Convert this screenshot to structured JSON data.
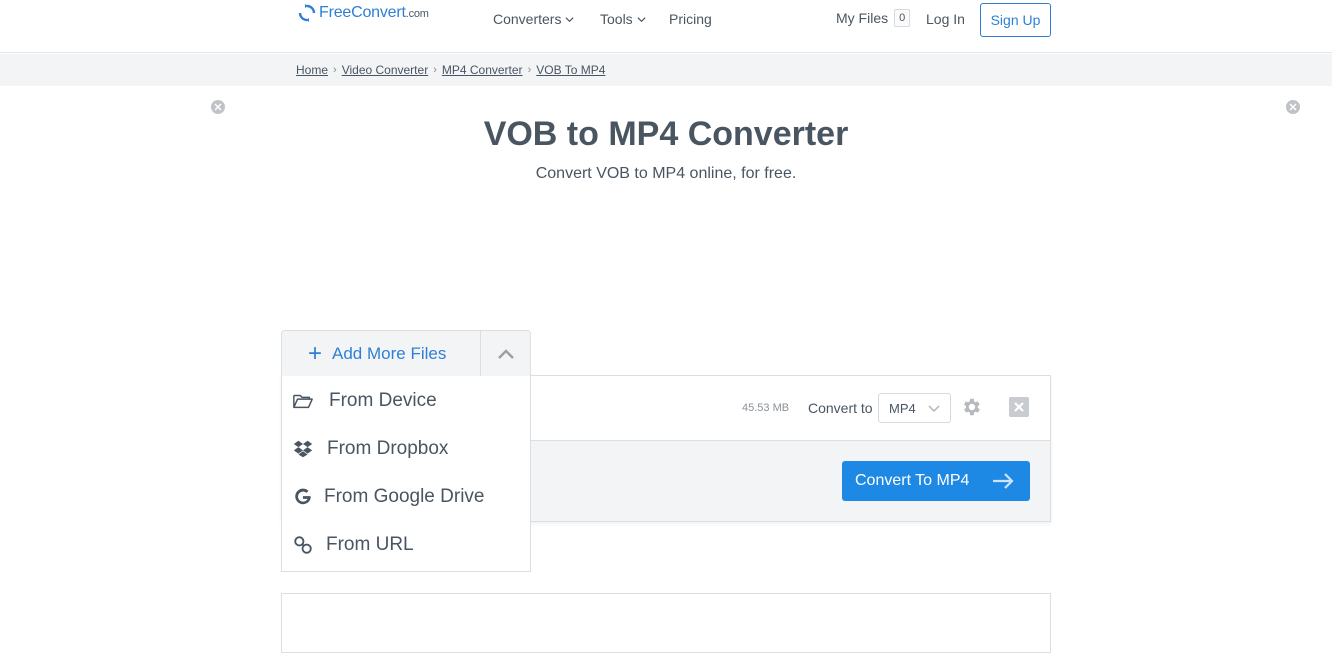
{
  "header": {
    "logo_name": "FreeConvert",
    "logo_domain": ".com",
    "nav": [
      {
        "label": "Converters",
        "has_dropdown": true
      },
      {
        "label": "Tools",
        "has_dropdown": true
      },
      {
        "label": "Pricing",
        "has_dropdown": false
      }
    ],
    "my_files_label": "My Files",
    "my_files_count": "0",
    "login_label": "Log In",
    "signup_label": "Sign Up"
  },
  "breadcrumb": [
    "Home",
    "Video Converter",
    "MP4 Converter",
    "VOB To MP4"
  ],
  "page": {
    "title": "VOB to MP4 Converter",
    "subtitle": "Convert VOB to MP4 online, for free."
  },
  "uploader": {
    "add_more_label": "Add More Files",
    "sources": [
      {
        "label": "From Device",
        "icon": "folder-open-icon"
      },
      {
        "label": "From Dropbox",
        "icon": "dropbox-icon"
      },
      {
        "label": "From Google Drive",
        "icon": "google-icon"
      },
      {
        "label": "From URL",
        "icon": "link-icon"
      }
    ]
  },
  "file": {
    "size": "45.53 MB",
    "convert_to_label": "Convert to",
    "format": "MP4"
  },
  "convert_button_label": "Convert To MP4",
  "colors": {
    "accent": "#2f7fd6",
    "primary_button": "#1e88e5",
    "text": "#4a5562",
    "panel_bg": "#f3f4f5"
  }
}
